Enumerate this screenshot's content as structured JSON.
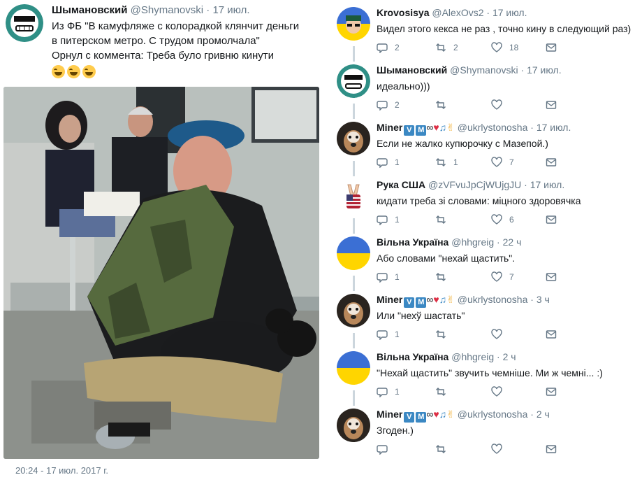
{
  "original": {
    "author_name": "Шымановский",
    "author_handle": "@Shymanovski",
    "separator": "·",
    "time": "17 июл.",
    "text_lines": [
      "Из ФБ \"В камуфляже с колорадкой клянчит деньги",
      "в питерском метро. С трудом промолчала\"",
      "Орнул с коммента: Треба було гривню кинути"
    ],
    "emoji": [
      "face-with-tears-of-joy",
      "face-with-tears-of-joy",
      "face-with-tears-of-joy"
    ],
    "date_footer": "20:24 - 17 июл. 2017 г."
  },
  "replies": [
    {
      "name": "Krovosisya",
      "handle": "@AlexOvs2",
      "time": "17 июл.",
      "text": "Видел этого кекса не раз , точно кину в следующий раз)",
      "replies_count": "2",
      "retweets_count": "2",
      "likes_count": "18",
      "avatar": "ukraine-flag-character-avatar"
    },
    {
      "name": "Шымановский",
      "handle": "@Shymanovski",
      "time": "17 июл.",
      "text": "идеально)))",
      "replies_count": "2",
      "retweets_count": "",
      "likes_count": "",
      "avatar": "grinning-face-avatar"
    },
    {
      "name": "Miner",
      "name_emoji": "🇻🇲∞❤️🎧✌️",
      "handle": "@ukrlystonosha",
      "time": "17 июл.",
      "text": "Если не жалко купюрочку с Мазепой.)",
      "replies_count": "1",
      "retweets_count": "1",
      "likes_count": "7",
      "avatar": "dog-avatar"
    },
    {
      "name": "Рука США",
      "handle": "@zVFvuJpCjWUjgJU",
      "time": "17 июл.",
      "text": "кидати треба зі словами: міцного здоровячка",
      "replies_count": "1",
      "retweets_count": "",
      "likes_count": "6",
      "avatar": "usa-flag-hand-avatar"
    },
    {
      "name": "Вільна Україна",
      "handle": "@hhgreig",
      "time": "22 ч",
      "text": "Або словами \"нехай щастить\".",
      "replies_count": "1",
      "retweets_count": "",
      "likes_count": "7",
      "avatar": "ukraine-flag-avatar"
    },
    {
      "name": "Miner",
      "name_emoji": "🇻🇲∞❤️🎧✌️",
      "handle": "@ukrlystonosha",
      "time": "3 ч",
      "text": "Или \"нехў шастать\"",
      "replies_count": "1",
      "retweets_count": "",
      "likes_count": "",
      "avatar": "dog-avatar"
    },
    {
      "name": "Вільна Україна",
      "handle": "@hhgreig",
      "time": "2 ч",
      "text": "\"Нехай щастить\" звучить чемніше. Ми ж чемні... :)",
      "replies_count": "1",
      "retweets_count": "",
      "likes_count": "",
      "avatar": "ukraine-flag-avatar"
    },
    {
      "name": "Miner",
      "name_emoji": "🇻🇲∞❤️🎧✌️",
      "handle": "@ukrlystonosha",
      "time": "2 ч",
      "text": "Згоден.)",
      "replies_count": "",
      "retweets_count": "",
      "likes_count": "",
      "avatar": "dog-avatar"
    }
  ],
  "colors": {
    "text": "#14171a",
    "muted": "#657786",
    "thread_line": "#ccd6dd",
    "ukraine_blue": "#3b6fd4",
    "ukraine_yellow": "#ffd500"
  }
}
